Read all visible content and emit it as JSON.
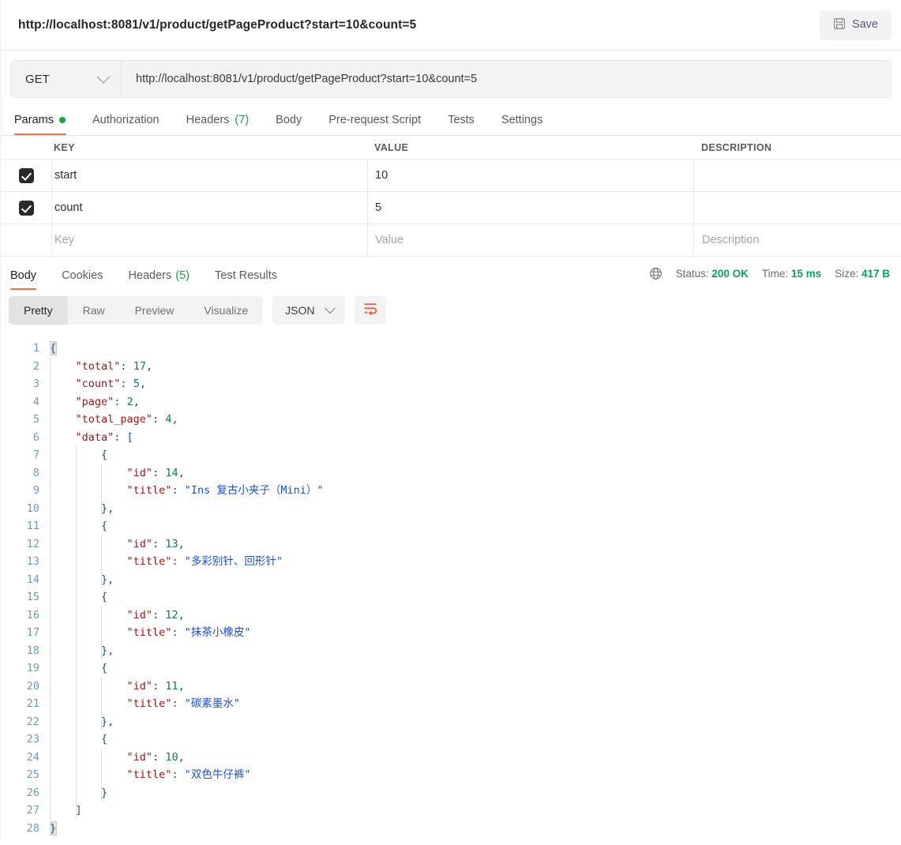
{
  "header": {
    "request_title": "http://localhost:8081/v1/product/getPageProduct?start=10&count=5",
    "save_label": "Save",
    "save_icon": "floppy-disk-icon"
  },
  "url_bar": {
    "method": "GET",
    "method_chevron_icon": "chevron-down-icon",
    "url": "http://localhost:8081/v1/product/getPageProduct?start=10&count=5"
  },
  "request_tabs": [
    {
      "label": "Params",
      "badge": "",
      "dot": true,
      "active": true
    },
    {
      "label": "Authorization",
      "badge": "",
      "dot": false,
      "active": false
    },
    {
      "label": "Headers",
      "badge": "(7)",
      "dot": false,
      "active": false
    },
    {
      "label": "Body",
      "badge": "",
      "dot": false,
      "active": false
    },
    {
      "label": "Pre-request Script",
      "badge": "",
      "dot": false,
      "active": false
    },
    {
      "label": "Tests",
      "badge": "",
      "dot": false,
      "active": false
    },
    {
      "label": "Settings",
      "badge": "",
      "dot": false,
      "active": false
    }
  ],
  "params_table": {
    "columns": {
      "key": "KEY",
      "value": "VALUE",
      "description": "DESCRIPTION"
    },
    "rows": [
      {
        "checked": true,
        "key": "start",
        "value": "10",
        "description": ""
      },
      {
        "checked": true,
        "key": "count",
        "value": "5",
        "description": ""
      }
    ],
    "placeholders": {
      "key": "Key",
      "value": "Value",
      "description": "Description"
    }
  },
  "response_tabs": [
    {
      "label": "Body",
      "badge": "",
      "active": true
    },
    {
      "label": "Cookies",
      "badge": "",
      "active": false
    },
    {
      "label": "Headers",
      "badge": "(5)",
      "active": false
    },
    {
      "label": "Test Results",
      "badge": "",
      "active": false
    }
  ],
  "response_meta": {
    "globe_icon": "globe-icon",
    "status_label": "Status:",
    "status_value": "200 OK",
    "time_label": "Time:",
    "time_value": "15 ms",
    "size_label": "Size:",
    "size_value": "417 B"
  },
  "view_toolbar": {
    "segments": [
      {
        "label": "Pretty",
        "active": true
      },
      {
        "label": "Raw",
        "active": false
      },
      {
        "label": "Preview",
        "active": false
      },
      {
        "label": "Visualize",
        "active": false
      }
    ],
    "format": "JSON",
    "format_chevron_icon": "chevron-down-icon",
    "wrap_icon": "word-wrap-icon"
  },
  "response_body": {
    "line_numbers": [
      1,
      2,
      3,
      4,
      5,
      6,
      7,
      8,
      9,
      10,
      11,
      12,
      13,
      14,
      15,
      16,
      17,
      18,
      19,
      20,
      21,
      22,
      23,
      24,
      25,
      26,
      27,
      28
    ],
    "json": {
      "total": 17,
      "count": 5,
      "page": 2,
      "total_page": 4,
      "data": [
        {
          "id": 14,
          "title": "Ins 复古小夹子（Mini）"
        },
        {
          "id": 13,
          "title": "多彩别针、回形针"
        },
        {
          "id": 12,
          "title": "抹茶小橡皮"
        },
        {
          "id": 11,
          "title": "碳素墨水"
        },
        {
          "id": 10,
          "title": "双色牛仔裤"
        }
      ]
    }
  },
  "colors": {
    "accent": "#ff6c37",
    "success": "#16a34a",
    "status_green": "#0ea05a",
    "json_key": "#a31515",
    "json_string": "#1a4fd6",
    "json_number": "#0d7a5f"
  }
}
